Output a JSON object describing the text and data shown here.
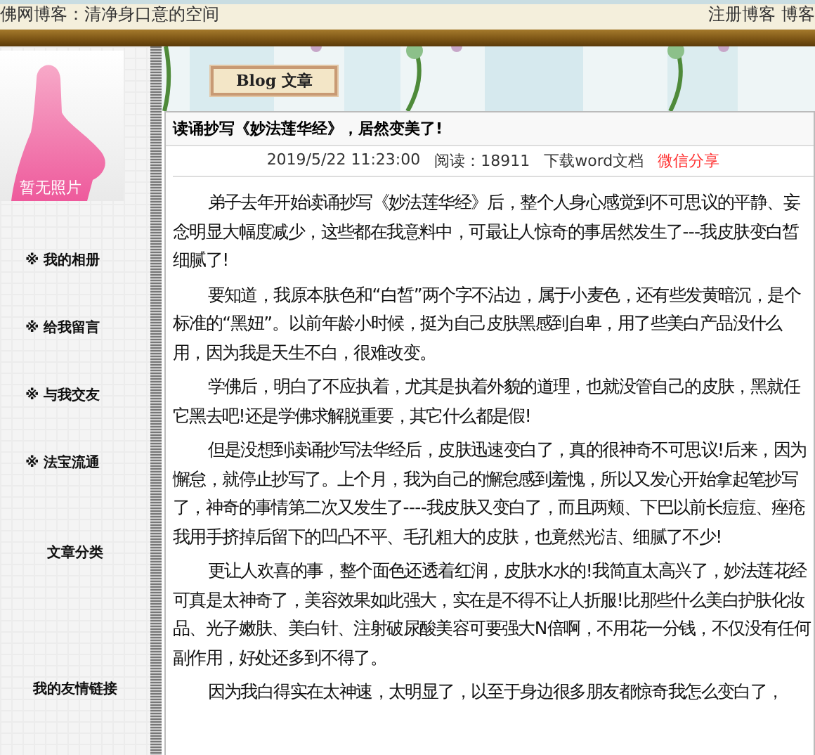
{
  "header": {
    "site_title": "佛网博客：清净身口意的空间",
    "links": "注册博客 博客"
  },
  "banner": {
    "badge": "Blog 文章"
  },
  "profile": {
    "photo_caption": "暂无照片"
  },
  "sidebar": {
    "items": [
      {
        "kind": "link",
        "label": "※ 我的相册"
      },
      {
        "kind": "link",
        "label": "※ 给我留言"
      },
      {
        "kind": "link",
        "label": "※ 与我交友"
      },
      {
        "kind": "link",
        "label": "※ 法宝流通"
      },
      {
        "kind": "heading",
        "label": "文章分类"
      },
      {
        "kind": "heading",
        "label": "我的友情链接"
      }
    ]
  },
  "article": {
    "title": "读诵抄写《妙法莲华经》，居然变美了!",
    "meta": {
      "datetime": "2019/5/22 11:23:00",
      "reads": "阅读：18911",
      "download": "下载word文档",
      "share": "微信分享"
    },
    "paragraphs": [
      "弟子去年开始读诵抄写《妙法莲华经》后，整个人身心感觉到不可思议的平静、妄念明显大幅度减少，这些都在我意料中，可最让人惊奇的事居然发生了---我皮肤变白皙细腻了!",
      "要知道，我原本肤色和“白皙”两个字不沾边，属于小麦色，还有些发黄暗沉，是个标准的“黑妞”。以前年龄小时候，挺为自己皮肤黑感到自卑，用了些美白产品没什么用，因为我是天生不白，很难改变。",
      "学佛后，明白了不应执着，尤其是执着外貌的道理，也就没管自己的皮肤，黑就任它黑去吧!还是学佛求解脱重要，其它什么都是假!",
      "但是没想到读诵抄写法华经后，皮肤迅速变白了，真的很神奇不可思议!后来，因为懈怠，就停止抄写了。上个月，我为自己的懈怠感到羞愧，所以又发心开始拿起笔抄写了，神奇的事情第二次又发生了----我皮肤又变白了，而且两颊、下巴以前长痘痘、痤疮我用手挤掉后留下的凹凸不平、毛孔粗大的皮肤，也竟然光洁、细腻了不少!",
      "更让人欢喜的事，整个面色还透着红润，皮肤水水的!我简直太高兴了，妙法莲花经可真是太神奇了，美容效果如此强大，实在是不得不让人折服!比那些什么美白护肤化妆品、光子嫩肤、美白针、注射破尿酸美容可要强大N倍啊，不用花一分钱，不仅没有任何副作用，好处还多到不得了。",
      "因为我白得实在太神速，太明显了，以至于身边很多朋友都惊奇我怎么变白了，"
    ]
  }
}
